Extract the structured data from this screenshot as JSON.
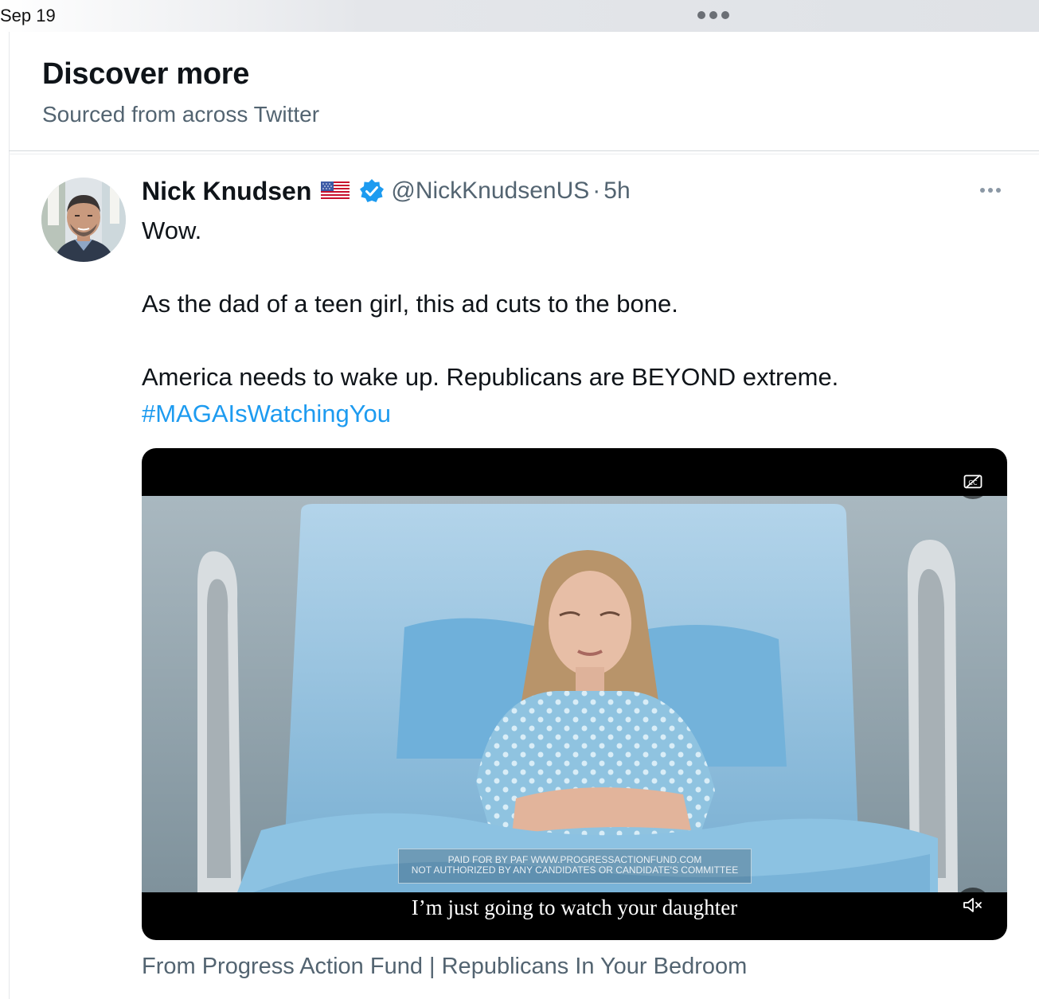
{
  "statusbar": {
    "date": "Sep 19"
  },
  "discover": {
    "title": "Discover more",
    "subtitle": "Sourced from across Twitter"
  },
  "tweet": {
    "author_name": "Nick Knudsen",
    "handle": "@NickKnudsenUS",
    "separator": "·",
    "time": "5h",
    "lines": [
      "Wow.",
      "As the dad of a teen girl, this ad cuts to the bone.",
      "America needs to wake up. Republicans are BEYOND extreme."
    ],
    "hashtag": "#MAGAIsWatchingYou",
    "flag_icon": "us-flag-icon",
    "verified_icon": "verified-badge-icon",
    "verified_color": "#1d9bf0"
  },
  "video": {
    "disclaimer_line1": "PAID FOR BY PAF WWW.PROGRESSACTIONFUND.COM",
    "disclaimer_line2": "NOT AUTHORIZED BY ANY CANDIDATES OR CANDIDATE'S COMMITTEE",
    "caption": "I’m just going to watch your daughter",
    "cc_icon": "closed-captions-off-icon",
    "mute_icon": "muted-speaker-icon"
  },
  "source_line": "From Progress Action Fund | Republicans In Your Bedroom",
  "colors": {
    "link": "#1d9bf0",
    "secondary_text": "#536471",
    "primary_text": "#0f1419"
  }
}
